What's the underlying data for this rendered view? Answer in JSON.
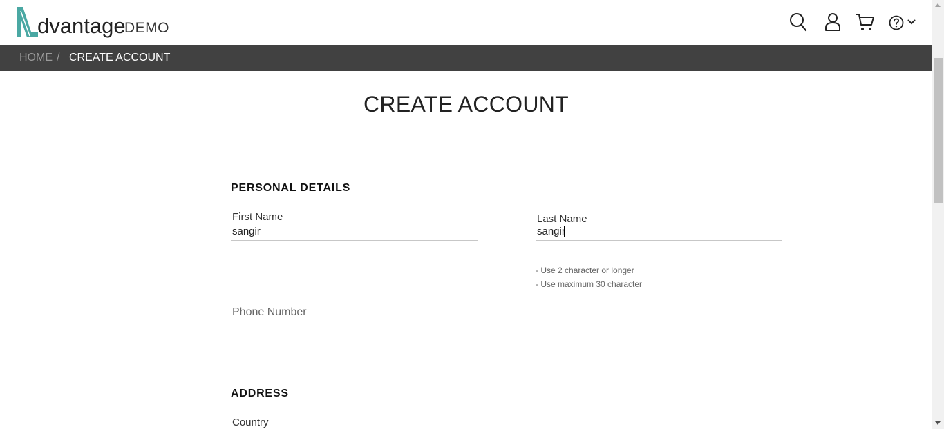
{
  "logo": {
    "main": "dvantage",
    "suffix": "DEMO",
    "accent_color": "#4aa8a3"
  },
  "header": {
    "icons": [
      "search-icon",
      "user-icon",
      "cart-icon",
      "help-icon",
      "chevron-down-icon"
    ]
  },
  "breadcrumb": {
    "home": "HOME",
    "separator": "/",
    "current": "CREATE ACCOUNT"
  },
  "page_title": "CREATE ACCOUNT",
  "personal_details": {
    "title": "PERSONAL DETAILS",
    "first_name": {
      "label": "First Name",
      "value": "sangir"
    },
    "last_name": {
      "label": "Last Name",
      "value": "sangir"
    },
    "hints": [
      "- Use 2 character or longer",
      "- Use maximum 30 character"
    ],
    "phone": {
      "placeholder": "Phone Number"
    }
  },
  "address": {
    "title": "ADDRESS",
    "country_label": "Country"
  },
  "colors": {
    "breadcrumb_bg": "#414141",
    "input_border": "#c7c7c7"
  }
}
